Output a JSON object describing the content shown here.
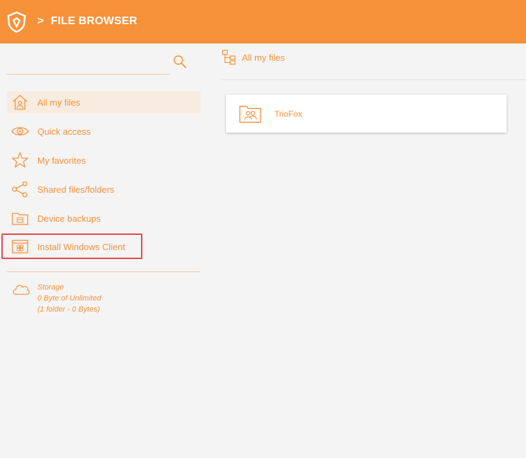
{
  "header": {
    "separator": ">",
    "title": "FILE BROWSER"
  },
  "sidebar": {
    "items": [
      {
        "label": "All my files",
        "icon": "home-icon",
        "active": true
      },
      {
        "label": "Quick access",
        "icon": "eye-icon",
        "active": false
      },
      {
        "label": "My favorites",
        "icon": "star-icon",
        "active": false
      },
      {
        "label": "Shared files/folders",
        "icon": "share-icon",
        "active": false
      },
      {
        "label": "Device backups",
        "icon": "backup-folder-icon",
        "active": false
      },
      {
        "label": "Install Windows Client",
        "icon": "windows-client-icon",
        "active": false,
        "highlighted": true
      }
    ],
    "storage": {
      "title": "Storage",
      "usage": "0 Byte of Unlimited",
      "details": "(1 folder - 0 Bytes)"
    }
  },
  "main": {
    "breadcrumb": "All my files",
    "folders": [
      {
        "name": "TrioFox",
        "icon": "shared-folder-icon"
      }
    ]
  },
  "colors": {
    "accent": "#f7923a",
    "highlight": "#e0474c"
  }
}
